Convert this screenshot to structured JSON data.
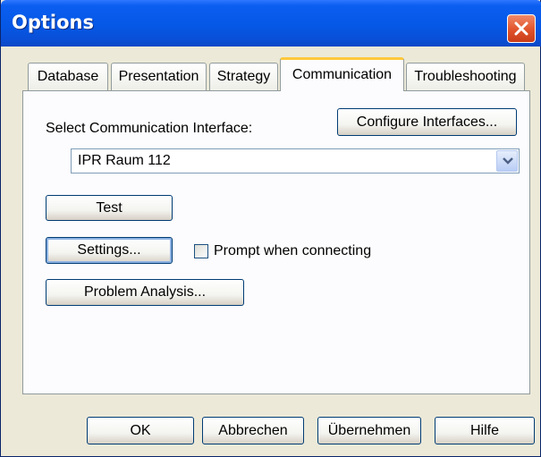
{
  "window": {
    "title": "Options",
    "close_icon": "close-icon"
  },
  "tabs": [
    {
      "label": "Database",
      "active": false
    },
    {
      "label": "Presentation",
      "active": false
    },
    {
      "label": "Strategy",
      "active": false
    },
    {
      "label": "Communication",
      "active": true
    },
    {
      "label": "Troubleshooting",
      "active": false
    }
  ],
  "communication": {
    "select_label": "Select Communication Interface:",
    "configure_button": "Configure Interfaces...",
    "interface_value": "IPR Raum 112",
    "test_button": "Test",
    "settings_button": "Settings...",
    "prompt_checkbox_label": "Prompt when connecting",
    "prompt_checked": false,
    "problem_button": "Problem Analysis..."
  },
  "footer": {
    "ok": "OK",
    "cancel": "Abbrechen",
    "apply": "Übernehmen",
    "help": "Hilfe"
  },
  "colors": {
    "titlebar": "#0558e6",
    "close_button": "#e0532b",
    "dialog_bg": "#ece9d8",
    "active_tab_accent": "#ffc83c"
  }
}
